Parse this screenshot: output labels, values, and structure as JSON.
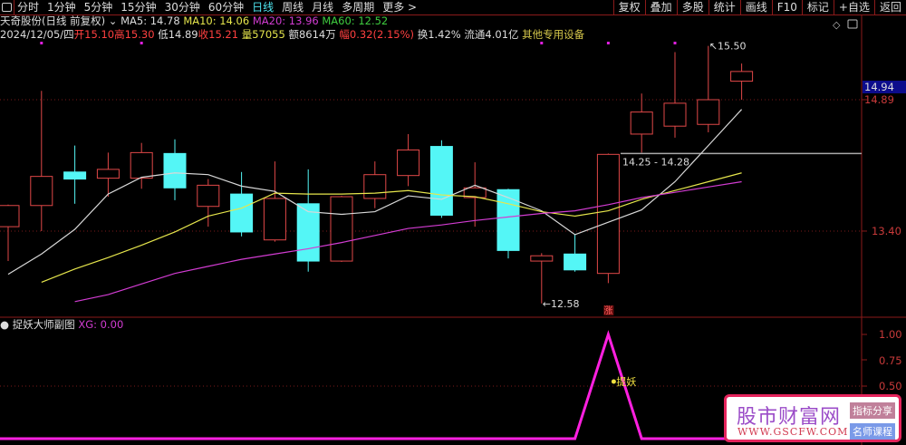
{
  "toolbar": {
    "periods": [
      "分时",
      "1分钟",
      "5分钟",
      "15分钟",
      "30分钟",
      "60分钟",
      "日线",
      "周线",
      "月线",
      "多周期",
      "更多 >"
    ],
    "active_period": "日线",
    "buttons": [
      "复权",
      "叠加",
      "多股",
      "统计",
      "画线",
      "F10",
      "标记",
      "+自选",
      "返回"
    ]
  },
  "info": {
    "title": "天奇股份(日线 前复权)",
    "ma5": "MA5: 14.78",
    "ma10": "MA10: 14.06",
    "ma20": "MA20: 13.96",
    "ma60": "MA60: 12.52",
    "date": "2024/12/05/四",
    "open": "开15.10",
    "high": "高15.30",
    "low": "低14.89",
    "close": "收15.21",
    "volume": "量57055",
    "amount": "额8614万",
    "change": "幅0.32(2.15%)",
    "turnover": "换1.42%",
    "float": "流通4.01亿",
    "industry": "其他专用设备"
  },
  "axis": {
    "current": "14.94",
    "p1": "14.89",
    "p2": "13.40",
    "s1": "1.00",
    "s2": "0.75",
    "s3": "0.50"
  },
  "annotations": {
    "high": "15.50",
    "low": "12.58",
    "range": "14.25 - 14.28",
    "rise_marker": "涨",
    "signal": "提妖"
  },
  "sub": {
    "title": "捉妖大师副图",
    "xg": "XG: 0.00"
  },
  "colors": {
    "up": "#e04848",
    "down": "#54f6f6",
    "ma5": "#d8d8d8",
    "ma10": "#e6e64c",
    "ma20": "#d23cd2",
    "xg": "#ff20e0"
  },
  "chart_data": {
    "type": "candlestick",
    "price_range": [
      12.45,
      15.52
    ],
    "candles": [
      [
        13.45,
        13.69,
        13.7,
        13.06
      ],
      [
        13.69,
        14.02,
        14.99,
        13.4
      ],
      [
        14.07,
        13.99,
        14.37,
        13.71
      ],
      [
        14.0,
        14.1,
        14.29,
        13.79
      ],
      [
        14.0,
        14.29,
        14.4,
        13.88
      ],
      [
        14.28,
        13.89,
        14.44,
        13.75
      ],
      [
        13.68,
        13.92,
        13.99,
        13.45
      ],
      [
        13.82,
        13.39,
        14.07,
        13.34
      ],
      [
        13.3,
        13.77,
        14.19,
        13.28
      ],
      [
        13.71,
        13.06,
        14.1,
        12.94
      ],
      [
        13.06,
        13.79,
        13.8,
        13.05
      ],
      [
        13.77,
        14.04,
        14.19,
        13.66
      ],
      [
        14.03,
        14.32,
        14.5,
        13.91
      ],
      [
        14.36,
        13.58,
        14.43,
        13.55
      ],
      [
        13.78,
        13.89,
        14.18,
        13.45
      ],
      [
        13.87,
        13.18,
        13.88,
        13.09
      ],
      [
        13.06,
        13.12,
        13.15,
        12.58
      ],
      [
        13.14,
        12.96,
        13.36,
        12.94
      ],
      [
        12.92,
        14.27,
        14.28,
        12.81
      ],
      [
        14.5,
        14.75,
        14.96,
        14.29
      ],
      [
        14.59,
        14.85,
        15.43,
        14.46
      ],
      [
        14.61,
        14.89,
        15.5,
        14.52
      ],
      [
        15.1,
        15.21,
        15.3,
        14.89
      ]
    ],
    "ma5": [
      12.91,
      13.14,
      13.42,
      13.82,
      14.01,
      14.06,
      14.04,
      13.91,
      13.85,
      13.62,
      13.59,
      13.62,
      13.8,
      13.76,
      13.92,
      13.78,
      13.63,
      13.36,
      13.5,
      13.64,
      13.96,
      14.37,
      14.78
    ],
    "ma10": [
      null,
      12.82,
      12.97,
      13.1,
      13.24,
      13.39,
      13.57,
      13.66,
      13.83,
      13.82,
      13.82,
      13.83,
      13.86,
      13.81,
      13.79,
      13.71,
      13.62,
      13.57,
      13.63,
      13.76,
      13.86,
      13.96,
      14.06
    ],
    "ma20": [
      null,
      null,
      12.6,
      12.68,
      12.8,
      12.92,
      13.0,
      13.08,
      13.14,
      13.2,
      13.27,
      13.35,
      13.43,
      13.47,
      13.52,
      13.56,
      13.6,
      13.63,
      13.7,
      13.78,
      13.84,
      13.9,
      13.96
    ],
    "marks": [
      1,
      4,
      16,
      18,
      20
    ],
    "xg": [
      0,
      0,
      0,
      0,
      0,
      0,
      0,
      0,
      0,
      0,
      0,
      0,
      0,
      0,
      0,
      0,
      0,
      0,
      1,
      0,
      0,
      0,
      0
    ],
    "sub_range": [
      0,
      1
    ]
  },
  "watermark": {
    "title": "股市财富网",
    "url": "WWW.GSCFW.COM",
    "badge1": "指标分享",
    "badge2": "名师课程"
  }
}
